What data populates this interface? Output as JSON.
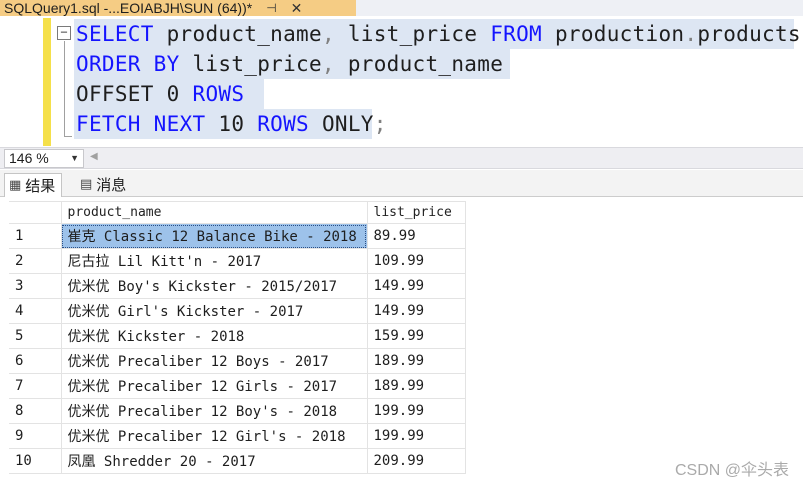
{
  "document_tab": {
    "title": "SQLQuery1.sql -...EOIABJH\\SUN (64))*",
    "pin_glyph": "⊣",
    "close_glyph": "✕"
  },
  "editor": {
    "fold_glyph": "−",
    "lines": [
      [
        {
          "t": "kw",
          "v": "SELECT"
        },
        {
          "t": "id",
          "v": " product_name"
        },
        {
          "t": "pu",
          "v": ","
        },
        {
          "t": "id",
          "v": " list_price "
        },
        {
          "t": "kw",
          "v": "FROM"
        },
        {
          "t": "id",
          "v": " production"
        },
        {
          "t": "pu",
          "v": "."
        },
        {
          "t": "id",
          "v": "products"
        }
      ],
      [
        {
          "t": "kw",
          "v": "ORDER BY"
        },
        {
          "t": "id",
          "v": " list_price"
        },
        {
          "t": "pu",
          "v": ","
        },
        {
          "t": "id",
          "v": " product_name"
        }
      ],
      [
        {
          "t": "id",
          "v": "OFFSET 0 "
        },
        {
          "t": "kw",
          "v": "ROWS"
        }
      ],
      [
        {
          "t": "kw",
          "v": "FETCH NEXT"
        },
        {
          "t": "id",
          "v": " 10 "
        },
        {
          "t": "kw",
          "v": "ROWS"
        },
        {
          "t": "id",
          "v": " ONLY"
        },
        {
          "t": "pu",
          "v": ";"
        }
      ]
    ]
  },
  "zoom": {
    "value": "146 %",
    "arrow": "▼",
    "scroll_glyph": "◀"
  },
  "results_tabs": [
    {
      "label": "结果",
      "icon": "grid-icon",
      "glyph": "▦",
      "active": true
    },
    {
      "label": "消息",
      "icon": "messages-icon",
      "glyph": "▤",
      "active": false
    }
  ],
  "grid": {
    "columns": [
      "product_name",
      "list_price"
    ],
    "rows": [
      [
        "1",
        "崔克 Classic 12 Balance Bike - 2018",
        "89.99"
      ],
      [
        "2",
        "尼古拉 Lil Kitt'n - 2017",
        "109.99"
      ],
      [
        "3",
        "优米优 Boy's Kickster - 2015/2017",
        "149.99"
      ],
      [
        "4",
        "优米优 Girl's Kickster - 2017",
        "149.99"
      ],
      [
        "5",
        "优米优 Kickster - 2018",
        "159.99"
      ],
      [
        "6",
        "优米优 Precaliber 12 Boys - 2017",
        "189.99"
      ],
      [
        "7",
        "优米优 Precaliber 12 Girls - 2017",
        "189.99"
      ],
      [
        "8",
        "优米优 Precaliber 12 Boy's - 2018",
        "199.99"
      ],
      [
        "9",
        "优米优 Precaliber 12 Girl's - 2018",
        "199.99"
      ],
      [
        "10",
        "凤凰 Shredder 20 - 2017",
        "209.99"
      ]
    ]
  },
  "watermark": "CSDN @伞头表"
}
